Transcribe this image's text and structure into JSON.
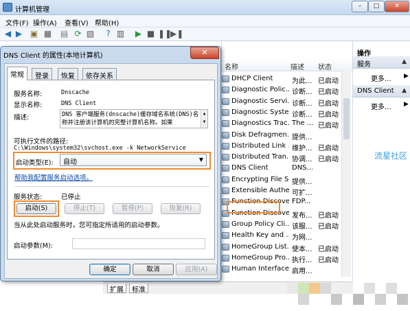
{
  "window": {
    "title": "计算机管理",
    "min": "–",
    "max": "□",
    "close": "✕"
  },
  "menu": [
    "文件(F)",
    "操作(A)",
    "查看(V)",
    "帮助(H)"
  ],
  "list": {
    "columns": {
      "name": "名称",
      "desc": "描述",
      "status": "状态"
    },
    "rows": [
      {
        "name": "DHCP Client",
        "desc": "为此...",
        "status": "已启动"
      },
      {
        "name": "Diagnostic Polic...",
        "desc": "诊断...",
        "status": "已启动"
      },
      {
        "name": "Diagnostic Servi...",
        "desc": "诊断...",
        "status": "已启动"
      },
      {
        "name": "Diagnostic Syste...",
        "desc": "诊断...",
        "status": "已启动"
      },
      {
        "name": "Diagnostics Trac...",
        "desc": "The ...",
        "status": "已启动"
      },
      {
        "name": "Disk Defragmen...",
        "desc": "提供...",
        "status": ""
      },
      {
        "name": "Distributed Link ...",
        "desc": "维护...",
        "status": "已启动"
      },
      {
        "name": "Distributed Tran...",
        "desc": "协调...",
        "status": "已启动"
      },
      {
        "name": "DNS Client",
        "desc": "DNS...",
        "status": ""
      },
      {
        "name": "Encrypting File S...",
        "desc": "提供...",
        "status": ""
      },
      {
        "name": "Extensible Authe...",
        "desc": "可扩...",
        "status": ""
      },
      {
        "name": "Function Discove...",
        "desc": "FDP...",
        "status": ""
      },
      {
        "name": "Function Discove...",
        "desc": "发布...",
        "status": "已启动"
      },
      {
        "name": "Group Policy Cli...",
        "desc": "该服...",
        "status": "已启动"
      },
      {
        "name": "Health Key and ...",
        "desc": "为网...",
        "status": ""
      },
      {
        "name": "HomeGroup List...",
        "desc": "使本...",
        "status": "已启动"
      },
      {
        "name": "HomeGroup Pro...",
        "desc": "执行...",
        "status": "已启动"
      },
      {
        "name": "Human Interface...",
        "desc": "启用...",
        "status": ""
      }
    ]
  },
  "status_tabs": [
    "扩展",
    "标准"
  ],
  "actions": {
    "header": "操作",
    "section1": "服务",
    "more1": "更多...",
    "section2": "DNS Client",
    "more2": "更多..."
  },
  "watermark": "流星社区",
  "dialog": {
    "title": "DNS Client 的属性(本地计算机)",
    "close": "✕",
    "tabs": [
      "常规",
      "登录",
      "恢复",
      "依存关系"
    ],
    "service_name_label": "服务名称:",
    "service_name": "Dnscache",
    "display_name_label": "显示名称:",
    "display_name": "DNS Client",
    "description_label": "描述:",
    "description": "DNS 客户端服务(dnscache)缓存域名系统(DNS)名称并注册该计算机的完整计算机名称。如果",
    "path_label": "可执行文件的路径:",
    "path": "C:\\Windows\\system32\\svchost.exe -k NetworkService",
    "startup_type_label": "启动类型(E):",
    "startup_type": "自动",
    "help_link": "帮助我配置服务启动选项。",
    "service_status_label": "服务状态:",
    "service_status": "已停止",
    "buttons": {
      "start": "启动(S)",
      "stop": "停止(T)",
      "pause": "暂停(P)",
      "resume": "恢复(R)"
    },
    "hint": "当从此处启动服务时，您可指定所适用的启动参数。",
    "params_label": "启动参数(M):",
    "params_value": "",
    "ok": "确定",
    "cancel": "取消",
    "apply": "应用(A)"
  },
  "colors": {
    "highlight": "#f08a2a",
    "titlebar": "#c5d9ef",
    "link": "#0645ad"
  }
}
